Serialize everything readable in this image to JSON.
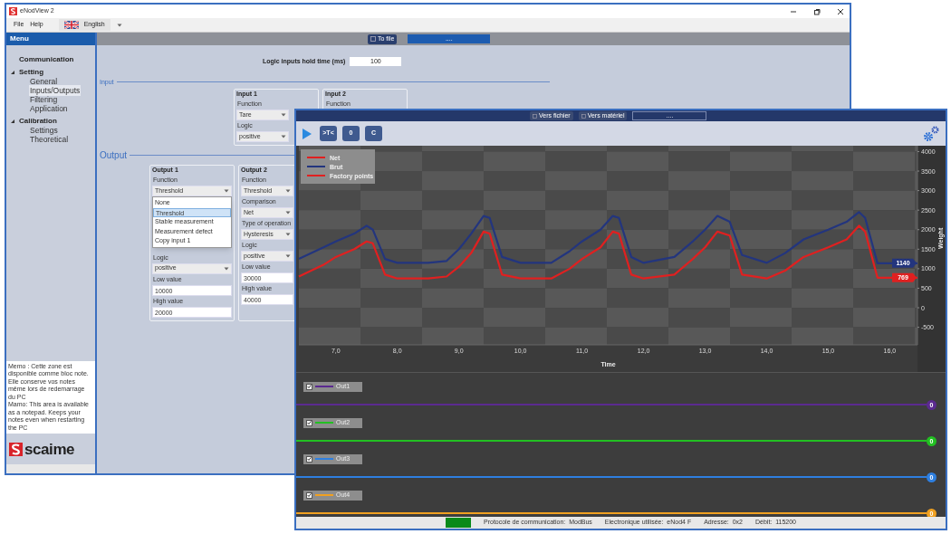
{
  "back_window": {
    "title": "eNodView 2",
    "menu": [
      "File",
      "Help"
    ],
    "language": "English",
    "sidebar": {
      "header": "Menu",
      "items": [
        {
          "label": "Communication",
          "selected": false
        },
        {
          "label": "Setting",
          "selected": false,
          "expanded": true,
          "children": [
            {
              "label": "General",
              "selected": false
            },
            {
              "label": "Inputs/Outputs",
              "selected": true
            },
            {
              "label": "Filtering",
              "selected": false
            },
            {
              "label": "Application",
              "selected": false
            }
          ]
        },
        {
          "label": "Calibration",
          "selected": false,
          "expanded": true,
          "children": [
            {
              "label": "Settings",
              "selected": false
            },
            {
              "label": "Theoretical",
              "selected": false
            }
          ]
        }
      ],
      "memo": "Memo : Cette zone est disponible comme bloc note. Elle conserve vos notes même lors de redemarrage du PC\nMamo: This area is available as a notepad. Keeps your notes even when restarting the PC",
      "logo": "scaime"
    },
    "toolbar": {
      "button": "To file",
      "field": "...."
    },
    "hold_time": {
      "label": "Logic inputs hold time (ms)",
      "value": "100"
    },
    "input_section": {
      "title": "Input",
      "groups": [
        {
          "title": "Input 1",
          "fields": [
            {
              "kind": "label",
              "text": "Function"
            },
            {
              "kind": "select",
              "text": "Tare"
            },
            {
              "kind": "label",
              "text": "Logic"
            },
            {
              "kind": "select",
              "text": "positive"
            }
          ]
        },
        {
          "title": "Input 2",
          "fields": [
            {
              "kind": "label",
              "text": "Function"
            }
          ]
        }
      ]
    },
    "output_section": {
      "title": "Output",
      "groups": [
        {
          "title": "Output 1",
          "fields": [
            {
              "kind": "label",
              "text": "Function"
            },
            {
              "kind": "select",
              "text": "Threshold",
              "options": [
                {
                  "label": "None",
                  "selected": false
                },
                {
                  "label": "Threshold",
                  "selected": true
                },
                {
                  "label": "Stable measurement",
                  "selected": false
                },
                {
                  "label": "Measurement defect",
                  "selected": false
                },
                {
                  "label": "Copy input 1",
                  "selected": false
                }
              ]
            },
            {
              "kind": "label",
              "text": "Logic"
            },
            {
              "kind": "select",
              "text": "positive"
            },
            {
              "kind": "label",
              "text": "Low value"
            },
            {
              "kind": "input",
              "text": "10000"
            },
            {
              "kind": "label",
              "text": "High value"
            },
            {
              "kind": "input",
              "text": "20000"
            }
          ]
        },
        {
          "title": "Output 2",
          "fields": [
            {
              "kind": "label",
              "text": "Function"
            },
            {
              "kind": "select",
              "text": "Threshold"
            },
            {
              "kind": "label",
              "text": "Comparison"
            },
            {
              "kind": "select",
              "text": "Net"
            },
            {
              "kind": "label",
              "text": "Type of operation"
            },
            {
              "kind": "select",
              "text": "Hysteresis"
            },
            {
              "kind": "label",
              "text": "Logic"
            },
            {
              "kind": "select",
              "text": "positive"
            },
            {
              "kind": "label",
              "text": "Low value"
            },
            {
              "kind": "input",
              "text": "30000"
            },
            {
              "kind": "label",
              "text": "High value"
            },
            {
              "kind": "input",
              "text": "40000"
            }
          ]
        }
      ]
    }
  },
  "front_window": {
    "title_buttons": [
      "Vers fichier",
      "Vers matériel"
    ],
    "field": "....",
    "toolbar": [
      {
        "kind": "play"
      },
      {
        "kind": "text",
        "label": ">T<"
      },
      {
        "kind": "text",
        "label": "0"
      },
      {
        "kind": "text",
        "label": "C"
      }
    ],
    "chart_data": {
      "type": "line",
      "xlabel": "Time",
      "ylabel": "Weight",
      "x": [
        6.4,
        6.8,
        7.0,
        7.3,
        7.5,
        7.6,
        7.8,
        8.0,
        8.5,
        8.8,
        9.0,
        9.2,
        9.4,
        9.5,
        9.7,
        10.0,
        10.5,
        10.8,
        11.0,
        11.3,
        11.5,
        11.6,
        11.8,
        12.0,
        12.5,
        12.8,
        13.0,
        13.2,
        13.4,
        13.6,
        14.0,
        14.3,
        14.6,
        15.0,
        15.3,
        15.5,
        15.6,
        15.8,
        16.0,
        16.45
      ],
      "series": [
        {
          "name": "Net",
          "color": "#e02020",
          "values": [
            800,
            1100,
            1300,
            1500,
            1700,
            1650,
            850,
            750,
            750,
            800,
            1050,
            1400,
            1950,
            1900,
            850,
            750,
            750,
            1000,
            1250,
            1550,
            1950,
            1900,
            850,
            750,
            850,
            1250,
            1550,
            1950,
            1850,
            850,
            750,
            950,
            1300,
            1550,
            1750,
            2100,
            1950,
            769,
            769,
            769
          ]
        },
        {
          "name": "Brut",
          "color": "#23357e",
          "values": [
            1250,
            1550,
            1700,
            1900,
            2100,
            2000,
            1250,
            1150,
            1150,
            1200,
            1500,
            1900,
            2350,
            2300,
            1300,
            1150,
            1150,
            1450,
            1700,
            2000,
            2350,
            2300,
            1300,
            1150,
            1300,
            1700,
            2000,
            2350,
            2200,
            1350,
            1150,
            1400,
            1750,
            2000,
            2200,
            2450,
            2300,
            1140,
            1140,
            1140
          ]
        },
        {
          "name": "Factory points",
          "color": "#e02020",
          "values": [
            null,
            null,
            null,
            null,
            null,
            null,
            null,
            null,
            null,
            null,
            null,
            null,
            null,
            null,
            null,
            null,
            null,
            null,
            null,
            null,
            null,
            null,
            null,
            null,
            null,
            null,
            null,
            null,
            null,
            null,
            null,
            null,
            null,
            null,
            null,
            null,
            null,
            null,
            null,
            null
          ]
        }
      ],
      "legend": true,
      "xlim": [
        6.4,
        16.45
      ],
      "ylim": [
        -950,
        4150
      ],
      "xticks": [
        {
          "value": 7,
          "label": "7,0"
        },
        {
          "value": 8,
          "label": "8,0"
        },
        {
          "value": 9,
          "label": "9,0"
        },
        {
          "value": 10,
          "label": "10,0"
        },
        {
          "value": 11,
          "label": "11,0"
        },
        {
          "value": 12,
          "label": "12,0"
        },
        {
          "value": 13,
          "label": "13,0"
        },
        {
          "value": 14,
          "label": "14,0"
        },
        {
          "value": 15,
          "label": "15,0"
        },
        {
          "value": 16,
          "label": "16,0"
        }
      ],
      "yticks": [
        4000,
        3500,
        3000,
        2500,
        2000,
        1500,
        1000,
        500,
        0,
        -500
      ],
      "annotations": [
        "1140",
        "769"
      ]
    },
    "outputs": [
      {
        "label": "Out1",
        "checked": true,
        "color": "#5b2a90",
        "value": "0"
      },
      {
        "label": "Out2",
        "checked": true,
        "color": "#22c022",
        "value": "0"
      },
      {
        "label": "Out3",
        "checked": true,
        "color": "#2e7fe0",
        "value": "0"
      },
      {
        "label": "Out4",
        "checked": true,
        "color": "#f0a020",
        "value": "0"
      }
    ],
    "status_bar": [
      "Protocole de communication:  ModBus",
      "Electronique utilisée:  eNod4 F",
      "Adresse:  0x2",
      "Débit:  115200"
    ]
  }
}
